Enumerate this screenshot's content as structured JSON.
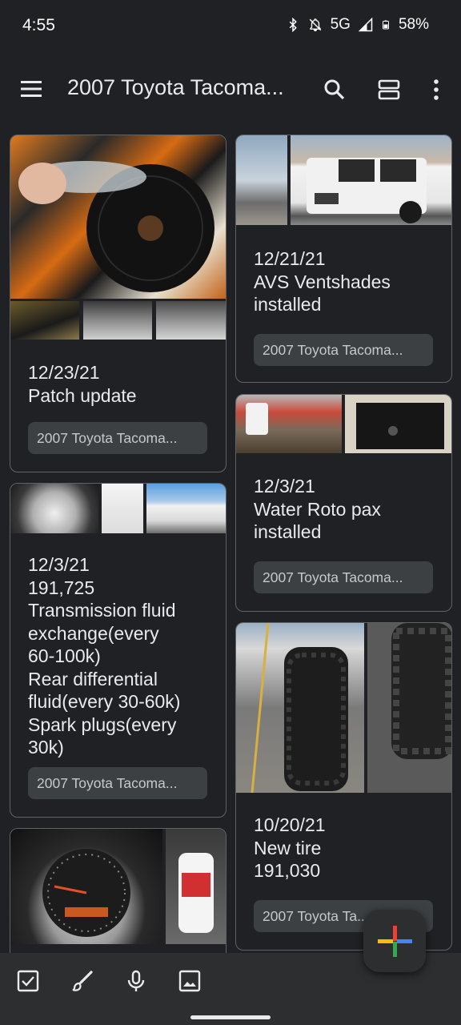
{
  "status_bar": {
    "time": "4:55",
    "network": "5G",
    "battery": "58%"
  },
  "app_bar": {
    "title": "2007 Toyota Tacoma..."
  },
  "notes": [
    {
      "id": "patch",
      "text": "12/23/21\nPatch update",
      "label": "2007 Toyota Tacoma..."
    },
    {
      "id": "ventshades",
      "text": "12/21/21\nAVS Ventshades\ninstalled",
      "label": "2007 Toyota Tacoma..."
    },
    {
      "id": "rotopax",
      "text": "12/3/21\nWater Roto pax\ninstalled",
      "label": "2007 Toyota Tacoma..."
    },
    {
      "id": "transmission",
      "text": "12/3/21\n191,725\nTransmission fluid\nexchange(every\n60-100k)\nRear differential\nfluid(every 30-60k)\nSpark plugs(every\n30k)",
      "label": "2007 Toyota Tacoma..."
    },
    {
      "id": "tire",
      "text": "10/20/21\nNew tire\n191,030",
      "label": "2007 Toyota Ta..."
    }
  ],
  "bottom_bar": {
    "icons": [
      "checkbox-icon",
      "brush-icon",
      "mic-icon",
      "image-icon"
    ]
  },
  "colors": {
    "background": "#202124",
    "card_border": "#5f6368",
    "chip_bg": "#3c4043",
    "text": "#e8eaed",
    "fab_blue": "#4285f4",
    "fab_red": "#ea4335",
    "fab_yellow": "#fbbc04",
    "fab_green": "#34a853"
  }
}
